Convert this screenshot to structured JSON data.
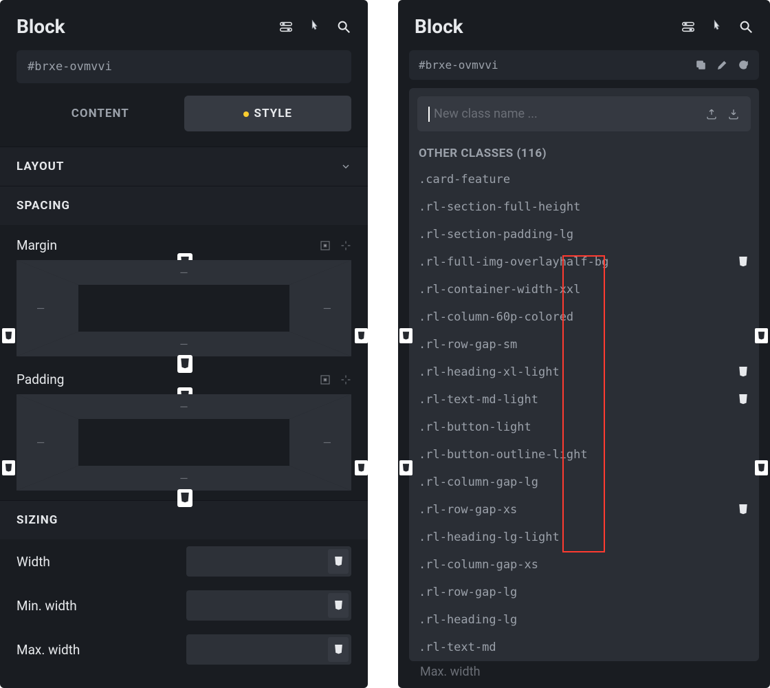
{
  "left": {
    "title": "Block",
    "selector": "#brxe-ovmvvi",
    "tabs": {
      "content": "CONTENT",
      "style": "STYLE"
    },
    "sections": {
      "layout": "LAYOUT",
      "spacing": "SPACING",
      "sizing": "SIZING"
    },
    "spacing": {
      "margin_label": "Margin",
      "padding_label": "Padding",
      "top": "–",
      "right": "–",
      "bottom": "–",
      "left": "–"
    },
    "sizing": {
      "width": "Width",
      "min_width": "Min. width",
      "max_width": "Max. width"
    }
  },
  "right": {
    "title": "Block",
    "selector": "#brxe-ovmvvi",
    "new_class_placeholder": "New class name ...",
    "other_classes_label": "OTHER CLASSES (116)",
    "classes": [
      {
        "name": ".card-feature",
        "badge": false
      },
      {
        "name": ".rl-section-full-height",
        "badge": false
      },
      {
        "name": ".rl-section-padding-lg",
        "badge": false
      },
      {
        "name": ".rl-full-img-overlayhalf-bg",
        "badge": true
      },
      {
        "name": ".rl-container-width-xxl",
        "badge": false
      },
      {
        "name": ".rl-column-60p-colored",
        "badge": false
      },
      {
        "name": ".rl-row-gap-sm",
        "badge": false
      },
      {
        "name": ".rl-heading-xl-light",
        "badge": true
      },
      {
        "name": ".rl-text-md-light",
        "badge": true
      },
      {
        "name": ".rl-button-light",
        "badge": false
      },
      {
        "name": ".rl-button-outline-light",
        "badge": false
      },
      {
        "name": ".rl-column-gap-lg",
        "badge": false
      },
      {
        "name": ".rl-row-gap-xs",
        "badge": true
      },
      {
        "name": ".rl-heading-lg-light",
        "badge": false
      },
      {
        "name": ".rl-column-gap-xs",
        "badge": false
      },
      {
        "name": ".rl-row-gap-lg",
        "badge": false
      },
      {
        "name": ".rl-heading-lg",
        "badge": false
      },
      {
        "name": ".rl-text-md",
        "badge": false
      }
    ],
    "faded_row_label": "Max. width"
  }
}
